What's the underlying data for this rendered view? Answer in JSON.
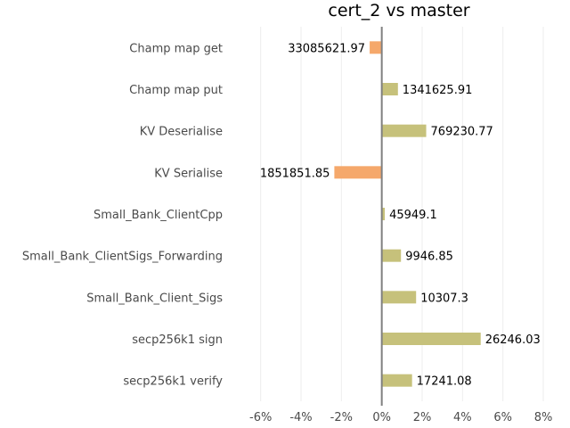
{
  "chart_data": {
    "type": "bar",
    "orientation": "horizontal",
    "title": "cert_2 vs master",
    "xlabel": "",
    "ylabel": "",
    "xlim": [
      -0.07,
      0.08
    ],
    "xticks": [
      -0.06,
      -0.04,
      -0.02,
      0,
      0.02,
      0.04,
      0.06,
      0.08
    ],
    "xtick_labels": [
      "-6%",
      "-4%",
      "-2%",
      "0%",
      "2%",
      "4%",
      "6%",
      "8%"
    ],
    "grid": true,
    "categories": [
      "Champ map get",
      "Champ map put",
      "KV Deserialise",
      "KV Serialise",
      "Small_Bank_ClientCpp",
      "Small_Bank_ClientSigs_Forwarding",
      "Small_Bank_Client_Sigs",
      "secp256k1 sign",
      "secp256k1 verify"
    ],
    "values": [
      -0.006,
      0.008,
      0.022,
      -0.0235,
      0.0015,
      0.0095,
      0.017,
      0.049,
      0.015
    ],
    "value_labels": [
      "33085621.97",
      "1341625.91",
      "769230.77",
      "1851851.85",
      "45949.1",
      "9946.85",
      "10307.3",
      "26246.03",
      "17241.08"
    ],
    "colors": {
      "positive": "#c6c17b",
      "negative": "#f5a86b",
      "zero_line": "#808080",
      "grid": "#eeeeee"
    }
  }
}
